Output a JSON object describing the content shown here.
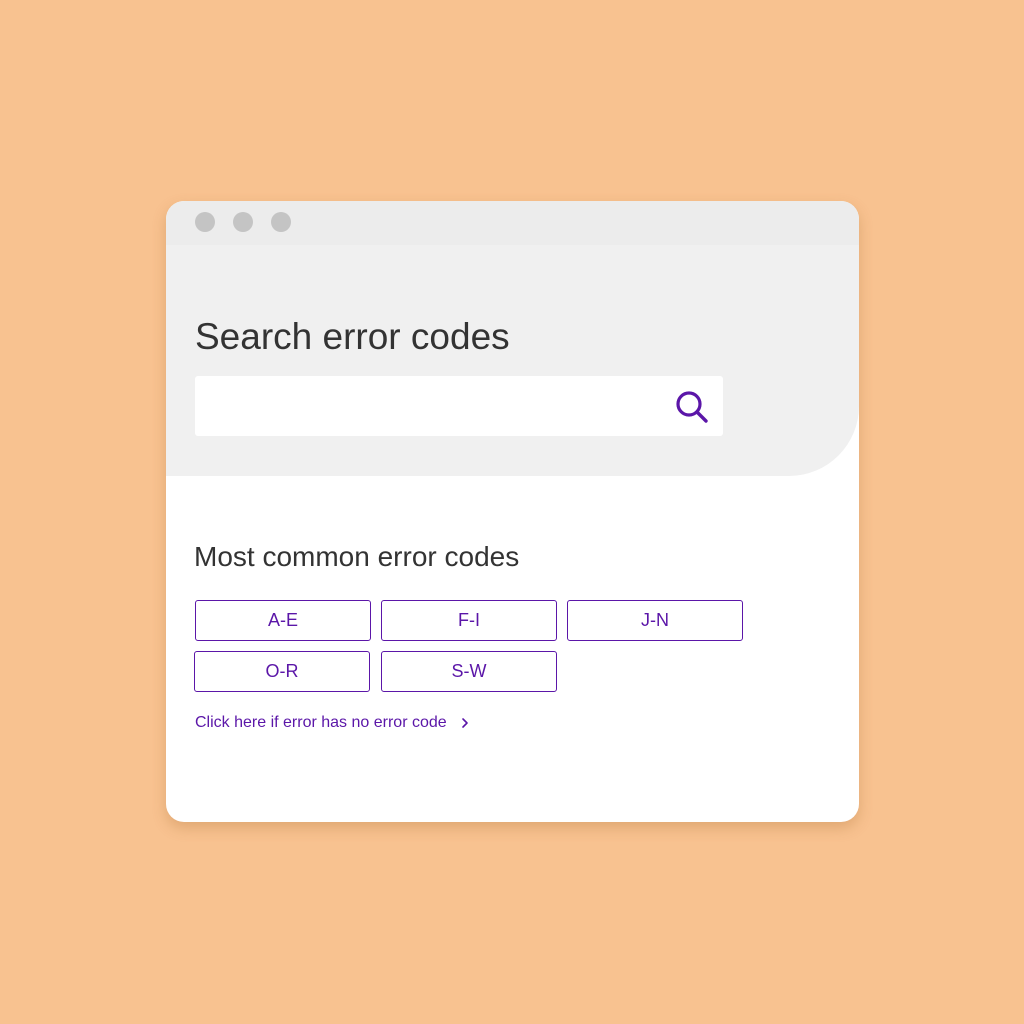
{
  "colors": {
    "background": "#f8c290",
    "accent": "#5b16a8",
    "hero_background": "#f0f0f0",
    "titlebar": "#ececec",
    "window_dots": "#c4c4c4",
    "heading_text": "#333333"
  },
  "window": {
    "controls": [
      "window-dot",
      "window-dot",
      "window-dot"
    ]
  },
  "search": {
    "title": "Search error codes",
    "input_value": "",
    "placeholder": "",
    "button_icon": "search-icon"
  },
  "common": {
    "title": "Most common error codes",
    "ranges": [
      {
        "label": "A-E"
      },
      {
        "label": "F-I"
      },
      {
        "label": "J-N"
      },
      {
        "label": "O-R"
      },
      {
        "label": "S-W"
      }
    ]
  },
  "no_code_link": {
    "label": "Click here if error has no error code",
    "icon": "chevron-right-icon"
  }
}
